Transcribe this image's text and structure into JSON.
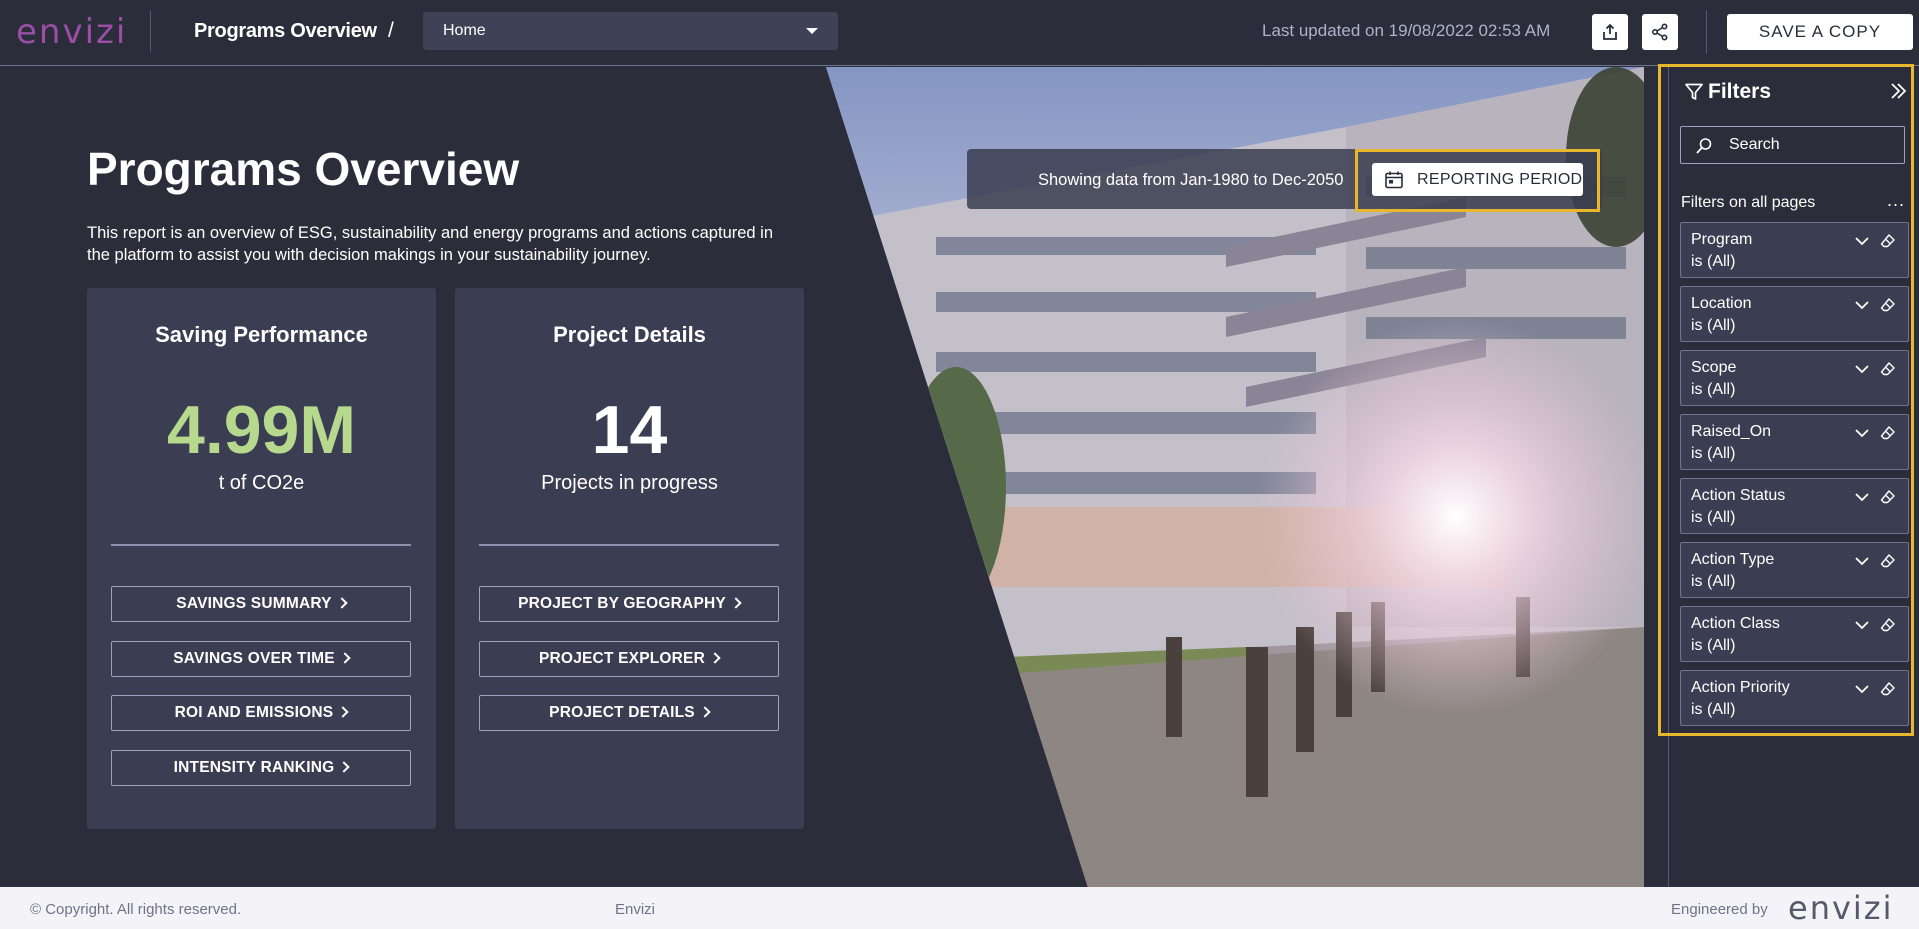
{
  "app": {
    "logo_text": "envizi",
    "brand_color": "#9a4ea6",
    "accent_color": "#e9b72b"
  },
  "header": {
    "title": "Programs Overview",
    "separator": "/",
    "page_select": {
      "selected": "Home"
    },
    "last_updated": "Last updated on 19/08/2022 02:53 AM",
    "export_icon": "export-icon",
    "share_icon": "share-icon",
    "save_copy_label": "SAVE A COPY"
  },
  "main": {
    "title": "Programs Overview",
    "description": "This report is an overview of ESG, sustainability and energy programs and actions captured in the platform to assist you with decision makings in your sustainability journey.",
    "period": {
      "text": "Showing data from Jan-1980 to Dec-2050",
      "button_label": "REPORTING PERIOD",
      "icon": "calendar-icon"
    },
    "cards": [
      {
        "title": "Saving Performance",
        "value": "4.99M",
        "value_color": "#b7d98e",
        "unit": "t of CO2e",
        "buttons": [
          "SAVINGS SUMMARY",
          "SAVINGS OVER TIME",
          "ROI AND EMISSIONS",
          "INTENSITY RANKING"
        ]
      },
      {
        "title": "Project Details",
        "value": "14",
        "value_color": "#ffffff",
        "unit": "Projects in progress",
        "buttons": [
          "PROJECT BY GEOGRAPHY",
          "PROJECT EXPLORER",
          "PROJECT DETAILS"
        ]
      }
    ]
  },
  "filters": {
    "heading": "Filters",
    "search_placeholder": "Search",
    "section_label": "Filters on all pages",
    "more_label": "...",
    "items": [
      {
        "name": "Program",
        "value": "is (All)"
      },
      {
        "name": "Location",
        "value": "is (All)"
      },
      {
        "name": "Scope",
        "value": "is (All)"
      },
      {
        "name": "Raised_On",
        "value": "is (All)"
      },
      {
        "name": "Action Status",
        "value": "is (All)"
      },
      {
        "name": "Action Type",
        "value": "is (All)"
      },
      {
        "name": "Action Class",
        "value": "is (All)"
      },
      {
        "name": "Action Priority",
        "value": "is (All)"
      }
    ]
  },
  "footer": {
    "copyright": "© Copyright. All rights reserved.",
    "center": "Envizi",
    "engineered_by": "Engineered by",
    "logo_text": "envizi"
  }
}
